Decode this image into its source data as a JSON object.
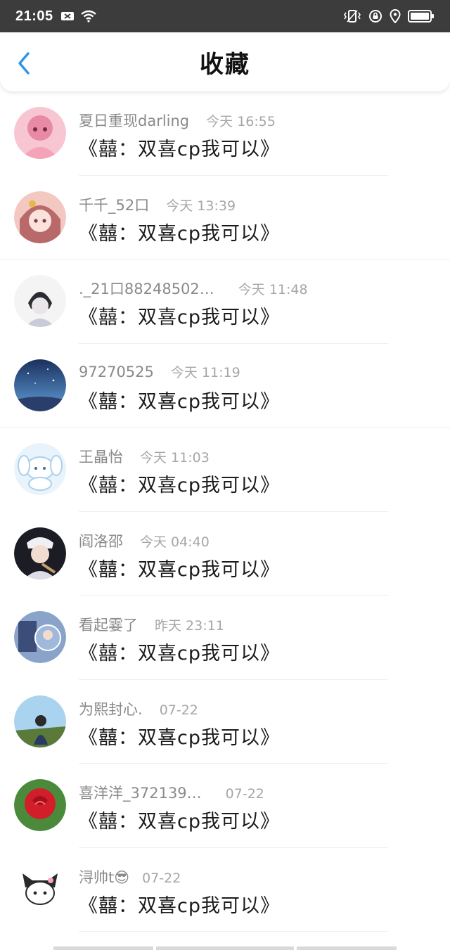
{
  "status": {
    "time": "21:05",
    "icons": [
      "mail-x-icon",
      "wifi-icon",
      "vibrate-icon",
      "lock-rotate-icon",
      "location-icon",
      "battery-icon"
    ]
  },
  "header": {
    "title": "收藏",
    "back_icon": "chevron-left-icon",
    "accent_color": "#2b95e9"
  },
  "items": [
    {
      "name": "夏日重现darling",
      "time": "今天  16:55",
      "title": "《囍：双喜cp我可以》",
      "avatar_colors": [
        "#f7c6d2",
        "#e88aa5"
      ]
    },
    {
      "name": "千千_52口",
      "time": "今天  13:39",
      "title": "《囍：双喜cp我可以》",
      "avatar_colors": [
        "#f2c8c0",
        "#b86a6a"
      ]
    },
    {
      "name": "._21口88248502…",
      "time": "今天  11:48",
      "title": "《囍：双喜cp我可以》",
      "avatar_colors": [
        "#f4f4f4",
        "#2b2b35"
      ]
    },
    {
      "name": "97270525",
      "time": "今天  11:19",
      "title": "《囍：双喜cp我可以》",
      "avatar_colors": [
        "#4c7fc4",
        "#1b2f5e"
      ]
    },
    {
      "name": "王晶怡",
      "time": "今天  11:03",
      "title": "《囍：双喜cp我可以》",
      "avatar_colors": [
        "#e8f3fb",
        "#a9d1ef"
      ]
    },
    {
      "name": "阎洛邵",
      "time": "今天  04:40",
      "title": "《囍：双喜cp我可以》",
      "avatar_colors": [
        "#d9dde6",
        "#1c1c24"
      ]
    },
    {
      "name": "看起霎了",
      "time": "昨天  23:11",
      "title": "《囍：双喜cp我可以》",
      "avatar_colors": [
        "#8aa3c9",
        "#3b4d78"
      ]
    },
    {
      "name": "为熙封心.",
      "time": "07-22",
      "title": "《囍：双喜cp我可以》",
      "avatar_colors": [
        "#a9d3ef",
        "#5a7a3a"
      ]
    },
    {
      "name": "喜洋洋_372139…",
      "time": "07-22",
      "title": "《囍：双喜cp我可以》",
      "avatar_colors": [
        "#d11e2a",
        "#4b8a3a"
      ]
    },
    {
      "name": "浔帅t😎",
      "time": "07-22",
      "title": "《囍：双喜cp我可以》",
      "avatar_colors": [
        "#ffffff",
        "#2a2a2a"
      ]
    }
  ]
}
